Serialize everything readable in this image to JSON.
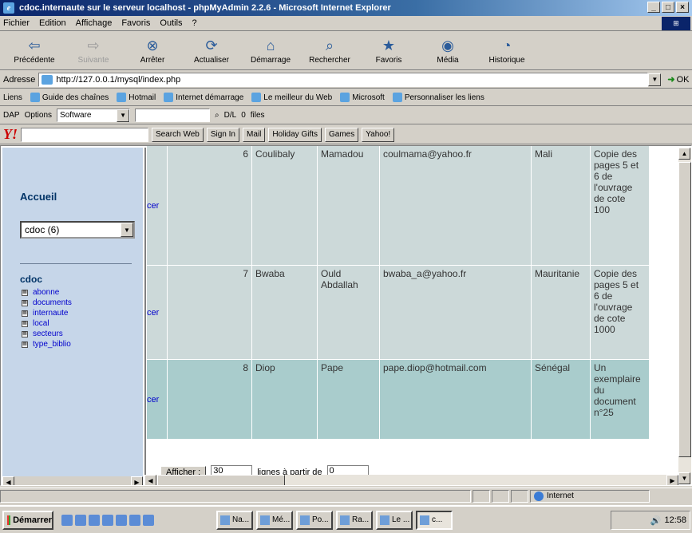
{
  "window": {
    "title": "cdoc.internaute sur le serveur localhost - phpMyAdmin 2.2.6 - Microsoft Internet Explorer"
  },
  "menu": [
    "Fichier",
    "Edition",
    "Affichage",
    "Favoris",
    "Outils",
    "?"
  ],
  "toolbar": [
    {
      "label": "Précédente",
      "icon": "back-icon",
      "enabled": true
    },
    {
      "label": "Suivante",
      "icon": "forward-icon",
      "enabled": false
    },
    {
      "label": "Arrêter",
      "icon": "stop-icon",
      "enabled": true
    },
    {
      "label": "Actualiser",
      "icon": "refresh-icon",
      "enabled": true
    },
    {
      "label": "Démarrage",
      "icon": "home-icon",
      "enabled": true
    },
    {
      "label": "Rechercher",
      "icon": "search-icon",
      "enabled": true
    },
    {
      "label": "Favoris",
      "icon": "favorites-icon",
      "enabled": true
    },
    {
      "label": "Média",
      "icon": "media-icon",
      "enabled": true
    },
    {
      "label": "Historique",
      "icon": "history-icon",
      "enabled": true
    }
  ],
  "address": {
    "label": "Adresse",
    "url": "http://127.0.0.1/mysql/index.php",
    "go": "OK"
  },
  "links": {
    "label": "Liens",
    "items": [
      "Guide des chaînes",
      "Hotmail",
      "Internet démarrage",
      "Le meilleur du Web",
      "Microsoft",
      "Personnaliser les liens"
    ]
  },
  "dapbar": {
    "dap": "DAP",
    "options": "Options",
    "software": "Software",
    "dl": "D/L",
    "dl_count": "0",
    "files": "files"
  },
  "yahoobar": {
    "search_web": "Search Web",
    "sign_in": "Sign In",
    "mail": "Mail",
    "holiday": "Holiday Gifts",
    "games": "Games",
    "yahoo": "Yahoo!"
  },
  "sidebar": {
    "home": "Accueil",
    "db_select": "cdoc (6)",
    "db_name": "cdoc",
    "tables": [
      "abonne",
      "documents",
      "internaute",
      "local",
      "secteurs",
      "type_biblio"
    ]
  },
  "table": {
    "rows": [
      {
        "action": "cer",
        "id": "6",
        "nom": "Coulibaly",
        "prenom": "Mamadou",
        "email": "coulmama@yahoo.fr",
        "pays": "Mali",
        "obs": [
          "Copie des",
          "pages 5 et",
          "6 de",
          "l'ouvrage",
          "de cote",
          "100"
        ]
      },
      {
        "action": "cer",
        "id": "7",
        "nom": "Bwaba",
        "prenom": "Ould Abdallah",
        "email": "bwaba_a@yahoo.fr",
        "pays": "Mauritanie",
        "obs": [
          "Copie des",
          "pages 5 et",
          "6 de",
          "l'ouvrage",
          "de cote",
          "1000"
        ]
      },
      {
        "action": "cer",
        "id": "8",
        "nom": "Diop",
        "prenom": "Pape",
        "email": "pape.diop@hotmail.com",
        "pays": "Sénégal",
        "obs": [
          "Un",
          "exemplaire",
          "du",
          "document",
          "n°25"
        ]
      }
    ]
  },
  "footer_form": {
    "afficher": "Afficher :",
    "count": "30",
    "text": "lignes à partir de",
    "start": "0"
  },
  "status": {
    "zone": "Internet"
  },
  "taskbar": {
    "start": "Démarrer",
    "tasks": [
      "Na...",
      "Mé...",
      "Po...",
      "Ra...",
      "Le ...",
      "c..."
    ],
    "clock": "12:58"
  }
}
